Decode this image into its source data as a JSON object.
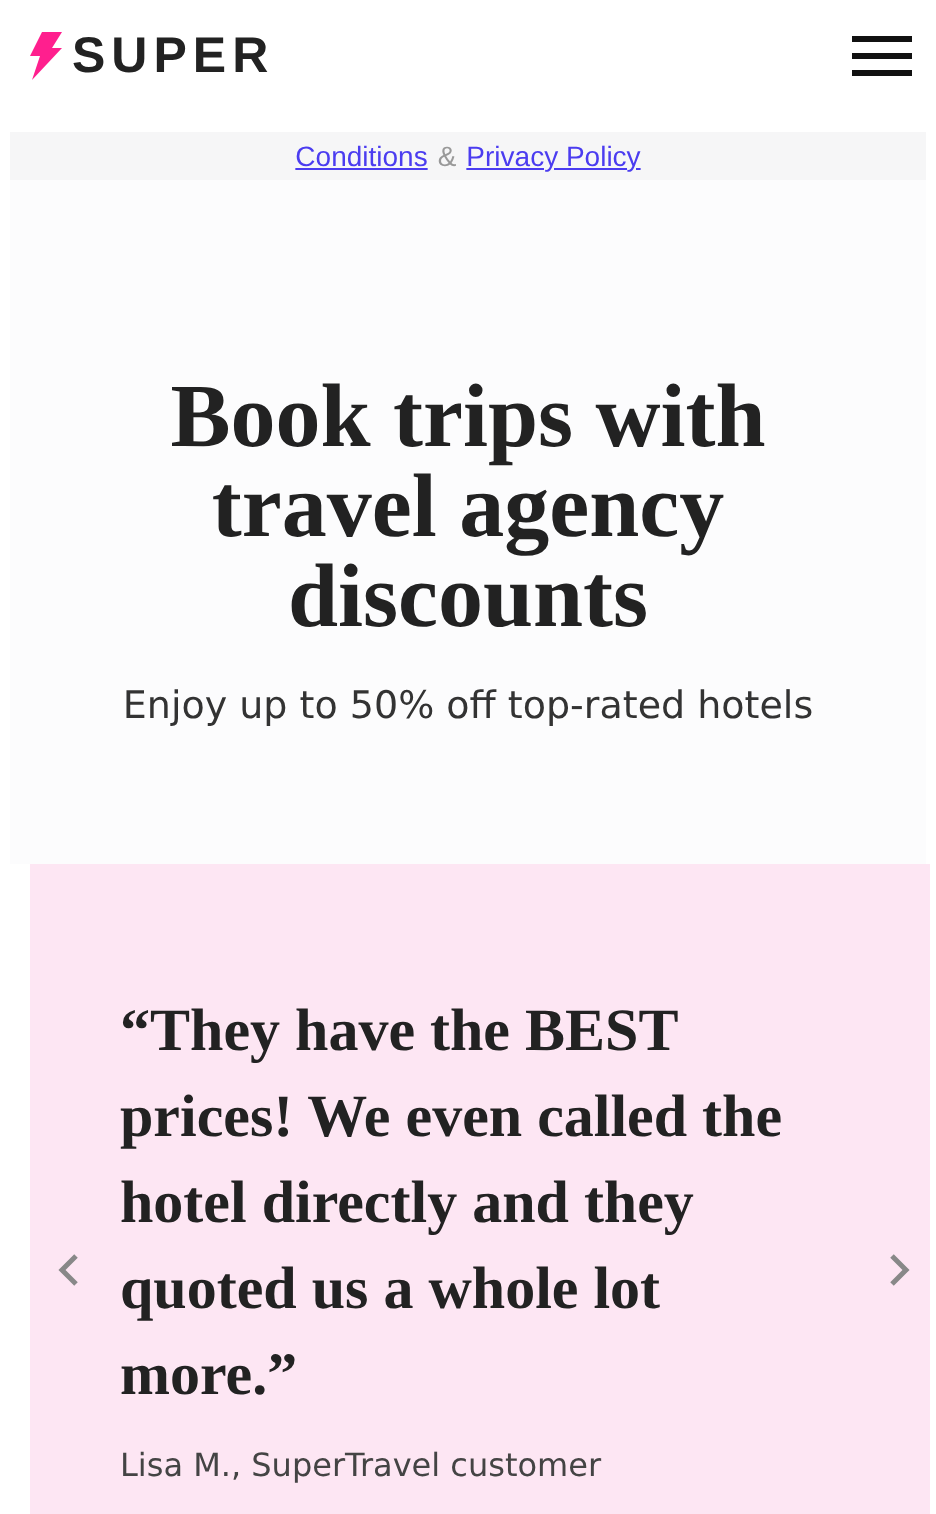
{
  "header": {
    "logo": "SUPER"
  },
  "legal_links": {
    "links": [
      "Conditions",
      "Privacy Policy"
    ],
    "separator": "&"
  },
  "hero": {
    "title": "Book trips with travel agency discounts",
    "subtitle": "Enjoy up to 50% off top-rated hotels"
  },
  "testimonial": {
    "quote": "“They have the BEST prices! We even called the hotel directly and they quoted us a whole lot more.”",
    "author": "Lisa M., SuperTravel customer"
  }
}
